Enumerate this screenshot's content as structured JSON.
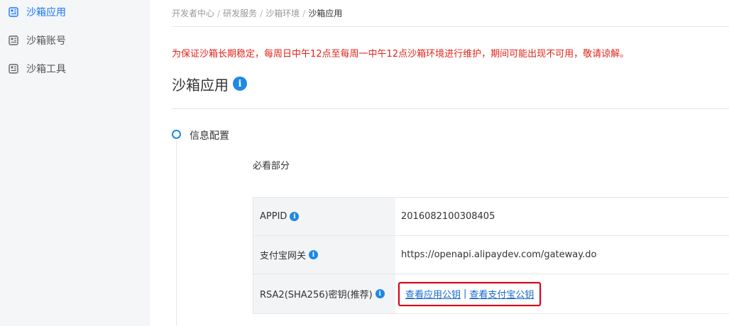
{
  "sidebar": {
    "items": [
      {
        "label": "沙箱应用",
        "active": true
      },
      {
        "label": "沙箱账号",
        "active": false
      },
      {
        "label": "沙箱工具",
        "active": false
      }
    ]
  },
  "breadcrumb": [
    "开发者中心",
    "研发服务",
    "沙箱环境",
    "沙箱应用"
  ],
  "breadcrumb_separator": "/",
  "notice": "为保证沙箱长期稳定，每周日中午12点至每周一中午12点沙箱环境进行维护，期间可能出现不可用，敬请谅解。",
  "page_title": "沙箱应用",
  "info_glyph": "i",
  "step": {
    "label": "信息配置"
  },
  "section_title": "必看部分",
  "config": {
    "appid_label": "APPID",
    "appid_value": "2016082100308405",
    "gateway_label": "支付宝网关",
    "gateway_value": "https://openapi.alipaydev.com/gateway.do",
    "rsa_label": "RSA2(SHA256)密钥(推荐)",
    "view_app_key": "查看应用公钥",
    "link_separator": "|",
    "view_alipay_key": "查看支付宝公钥"
  },
  "colors": {
    "accent": "#1e88e5",
    "link": "#1668c9",
    "notice": "#e2231a",
    "highlight_border": "#d0021b"
  },
  "icons": {
    "sidebar": "app-grid-icon",
    "info": "info-circle-icon",
    "step": "step-circle-icon"
  }
}
